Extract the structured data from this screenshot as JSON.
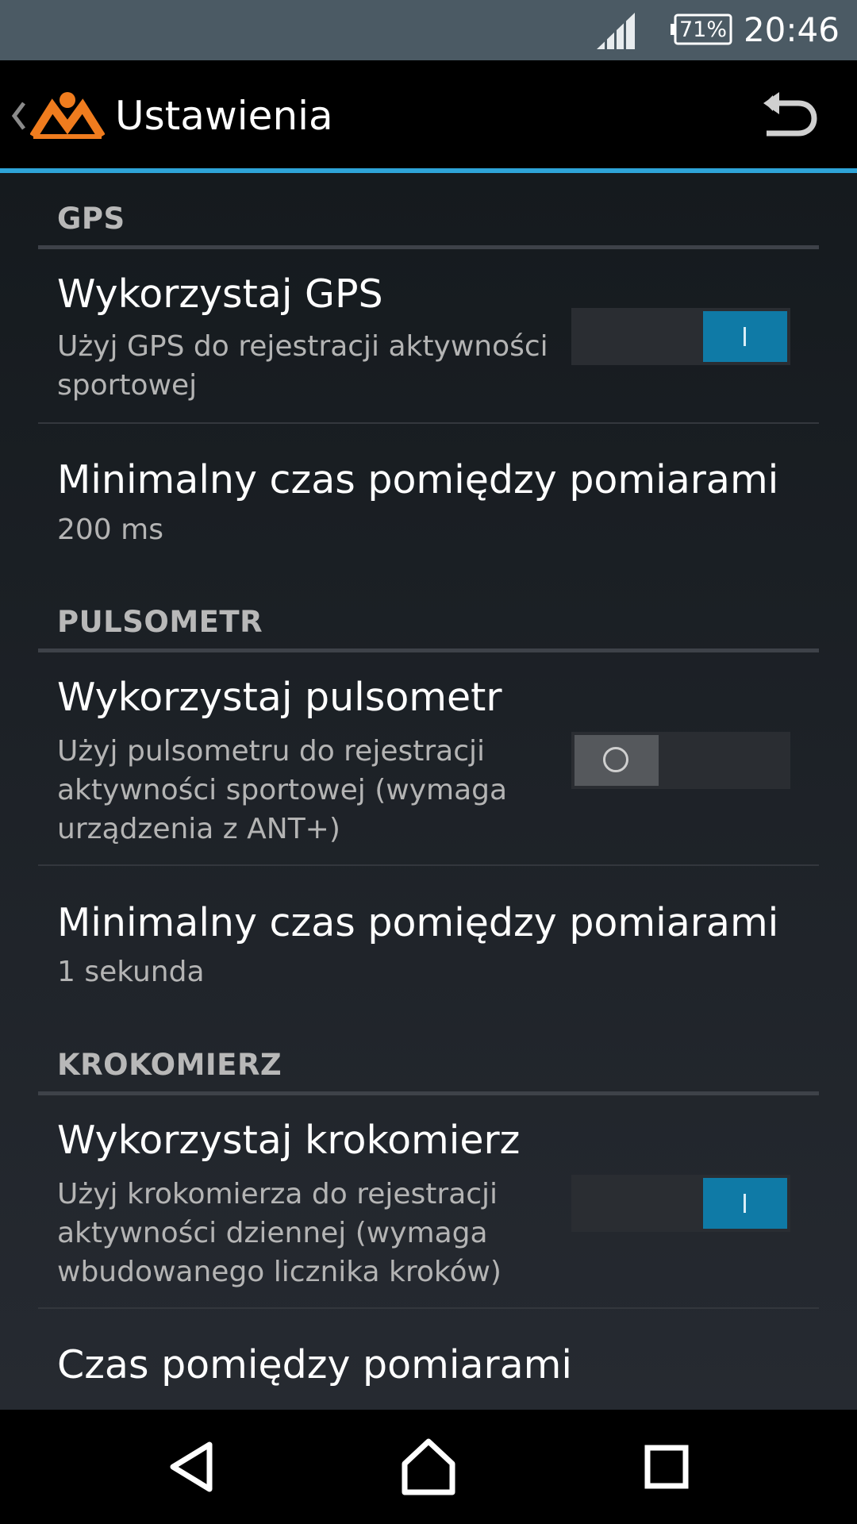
{
  "status_bar": {
    "battery": "71%",
    "time": "20:46"
  },
  "action_bar": {
    "title": "Ustawienia"
  },
  "sections": {
    "gps": {
      "header": "GPS",
      "use_gps": {
        "title": "Wykorzystaj GPS",
        "summary": "Użyj GPS do rejestracji aktywności sportowej",
        "enabled": true
      },
      "interval": {
        "title": "Minimalny czas pomiędzy pomiarami",
        "value": "200 ms"
      }
    },
    "heart_rate": {
      "header": "PULSOMETR",
      "use_hrm": {
        "title": "Wykorzystaj pulsometr",
        "summary": "Użyj pulsometru do rejestracji aktywności sportowej (wymaga urządzenia z ANT+)",
        "enabled": false
      },
      "interval": {
        "title": "Minimalny czas pomiędzy pomiarami",
        "value": "1 sekunda"
      }
    },
    "pedometer": {
      "header": "KROKOMIERZ",
      "use_pedometer": {
        "title": "Wykorzystaj krokomierz",
        "summary": "Użyj krokomierza do rejestracji aktywności dziennej (wymaga wbudowanego licznika kroków)",
        "enabled": true
      },
      "interval": {
        "title": "Czas pomiędzy pomiarami"
      }
    }
  },
  "colors": {
    "accent": "#2ea4d8",
    "switch_on": "#0f7aa6",
    "logo": "#f07c1e"
  }
}
